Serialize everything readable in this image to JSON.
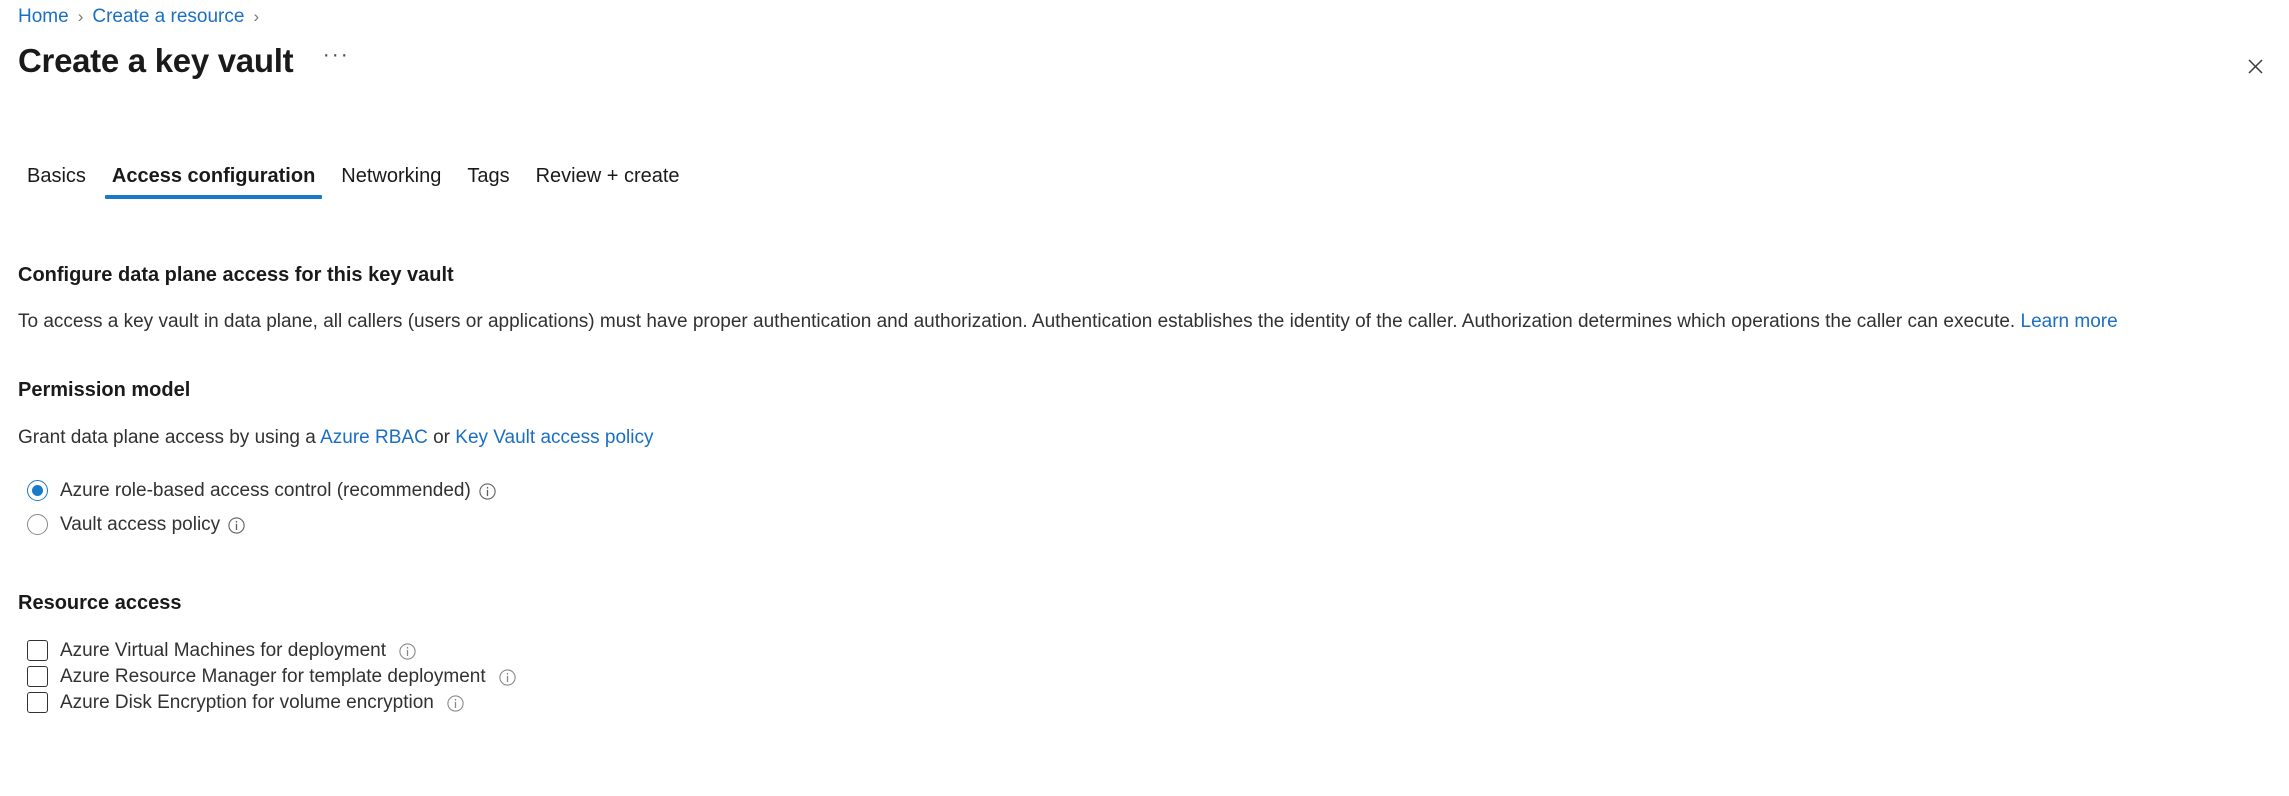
{
  "breadcrumb": {
    "items": [
      {
        "label": "Home"
      },
      {
        "label": "Create a resource"
      }
    ],
    "separator": "›"
  },
  "header": {
    "title": "Create a key vault",
    "more_label": "•••",
    "close_icon": "close-icon"
  },
  "tabs": [
    {
      "label": "Basics",
      "active": false
    },
    {
      "label": "Access configuration",
      "active": true
    },
    {
      "label": "Networking",
      "active": false
    },
    {
      "label": "Tags",
      "active": false
    },
    {
      "label": "Review + create",
      "active": false
    }
  ],
  "main": {
    "configure_section": {
      "heading": "Configure data plane access for this key vault",
      "description": "To access a key vault in data plane, all callers (users or applications) must have proper authentication and authorization. Authentication establishes the identity of the caller. Authorization determines which operations the caller can execute.",
      "learn_more": "Learn more"
    },
    "permission_model": {
      "heading": "Permission model",
      "description_prefix": "Grant data plane access by using a",
      "link_rbac": "Azure RBAC",
      "description_middle": "or",
      "link_policy": "Key Vault access policy",
      "options": [
        {
          "label": "Azure role-based access control (recommended)",
          "selected": true
        },
        {
          "label": "Vault access policy",
          "selected": false
        }
      ]
    },
    "resource_access": {
      "heading": "Resource access",
      "options": [
        {
          "label": "Azure Virtual Machines for deployment",
          "checked": false
        },
        {
          "label": "Azure Resource Manager for template deployment",
          "checked": false
        },
        {
          "label": "Azure Disk Encryption for volume encryption",
          "checked": false
        }
      ]
    }
  },
  "colors": {
    "accent": "#1a7ac9",
    "link": "#1a6fc4",
    "text": "#323130",
    "heading": "#1a1a1a",
    "border": "#8a8886"
  }
}
